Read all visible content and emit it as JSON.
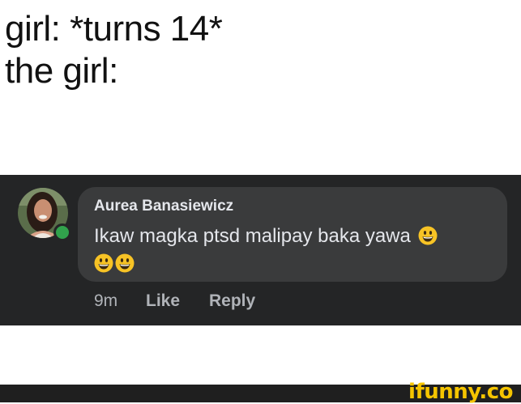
{
  "caption": {
    "line1": "girl: *turns 14*",
    "line2": "the girl:"
  },
  "comment": {
    "author": "Aurea Banasiewicz",
    "text": "Ikaw magka ptsd malipay baka yawa",
    "emoji_icon": "grinning-face-emoji",
    "time": "9m",
    "like_label": "Like",
    "reply_label": "Reply",
    "online": true
  },
  "colors": {
    "panel_bg": "#242526",
    "bubble_bg": "#3a3b3c",
    "online_green": "#31a24c",
    "watermark_yellow": "#f5c400"
  },
  "watermark": {
    "text": "ifunny.co"
  }
}
